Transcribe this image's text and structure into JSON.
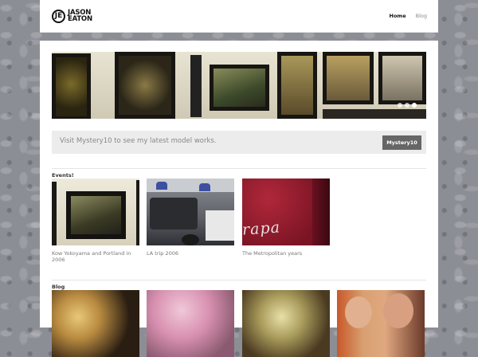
{
  "header": {
    "logo_initial": "JE",
    "logo_line1": "JASON",
    "logo_line2": "EATON",
    "nav": [
      {
        "label": "Home",
        "active": true
      },
      {
        "label": "Blog",
        "active": false
      }
    ]
  },
  "slider": {
    "dots": 3,
    "active_dot": 3
  },
  "banner": {
    "text": "Visit Mystery10 to see my latest model works.",
    "button": "Mystery10"
  },
  "events": {
    "title": "Events!",
    "items": [
      {
        "caption": "Kow Yokoyama and Portland in 2006",
        "image": "gallery-wall-photo"
      },
      {
        "caption": "LA trip 2006",
        "image": "police-car-photo"
      },
      {
        "caption": "The Metropolitan years",
        "image": "red-car-script-photo"
      }
    ]
  },
  "blog": {
    "title": "Blog",
    "items": [
      {
        "image": "sushi-photo"
      },
      {
        "image": "cherry-blossom-photo"
      },
      {
        "image": "food-bowl-photo"
      },
      {
        "image": "couple-selfie-photo"
      }
    ]
  }
}
